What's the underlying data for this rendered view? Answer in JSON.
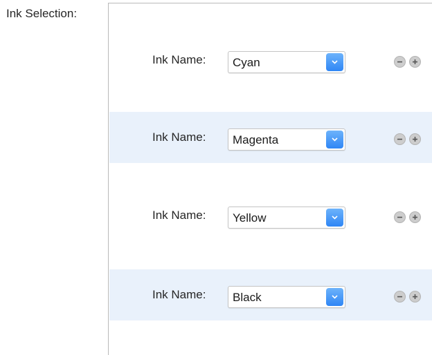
{
  "section_label": "Ink Selection:",
  "inks": [
    {
      "label": "Ink Name:",
      "value": "Cyan"
    },
    {
      "label": "Ink Name:",
      "value": "Magenta"
    },
    {
      "label": "Ink Name:",
      "value": "Yellow"
    },
    {
      "label": "Ink Name:",
      "value": "Black"
    }
  ],
  "colors": {
    "stripe": "#e9f1fb",
    "select_arrow": "#2f86f5"
  },
  "icons": {
    "dropdown": "chevron-down-icon",
    "remove": "minus-circle-icon",
    "add": "plus-circle-icon"
  }
}
